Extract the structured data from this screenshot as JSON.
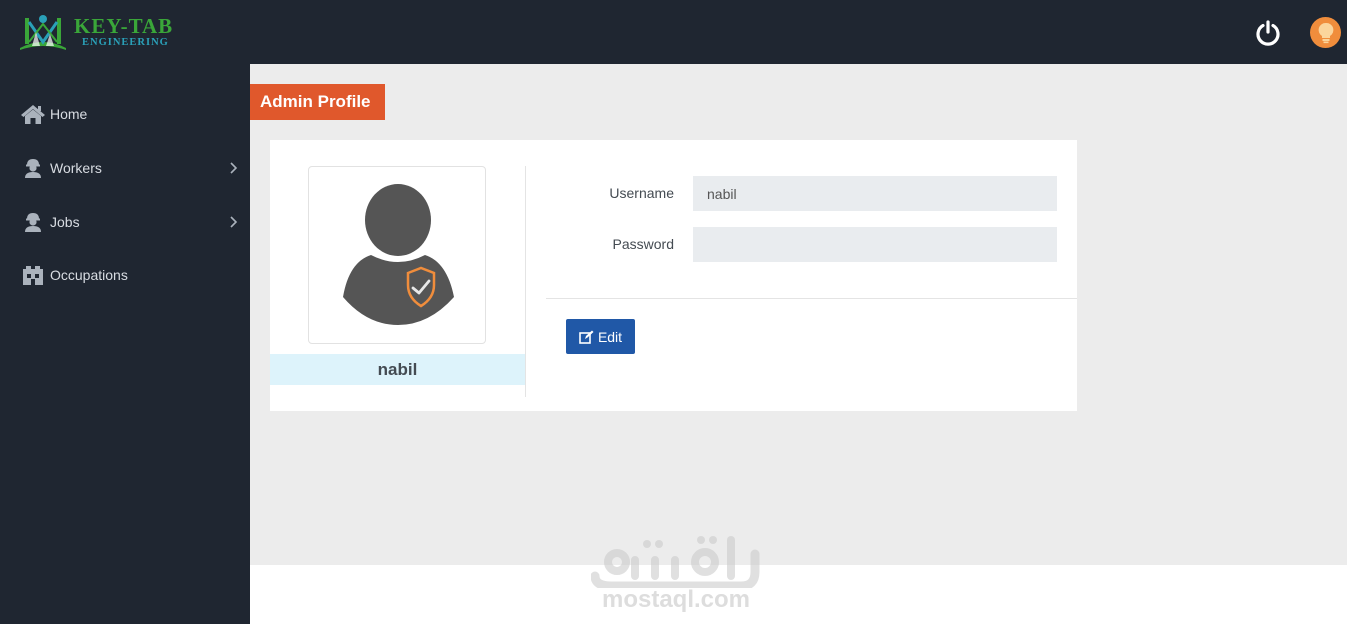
{
  "brand": {
    "title": "KEY-TAB",
    "subtitle": "ENGINEERING"
  },
  "header": {
    "power_icon": "power-icon",
    "avatar_icon": "lightbulb-icon"
  },
  "sidebar": {
    "items": [
      {
        "label": "Home",
        "icon": "home-icon",
        "has_submenu": false
      },
      {
        "label": "Workers",
        "icon": "worker-icon",
        "has_submenu": true
      },
      {
        "label": "Jobs",
        "icon": "worker-icon",
        "has_submenu": true
      },
      {
        "label": "Occupations",
        "icon": "industry-icon",
        "has_submenu": false
      }
    ]
  },
  "page": {
    "title": "Admin Profile"
  },
  "profile": {
    "name": "nabil",
    "avatar_icon": "admin-user-shield-icon",
    "fields": {
      "username_label": "Username",
      "username_value": "nabil",
      "password_label": "Password",
      "password_value": ""
    },
    "edit_label": "Edit"
  },
  "watermark": {
    "arabic": "مستقل",
    "latin": "mostaql.com"
  },
  "colors": {
    "nav_bg": "#1f2631",
    "title_accent": "#e0582c",
    "primary_button": "#2058a7",
    "name_bar": "#ddf3fb",
    "content_bg": "#ececec"
  }
}
